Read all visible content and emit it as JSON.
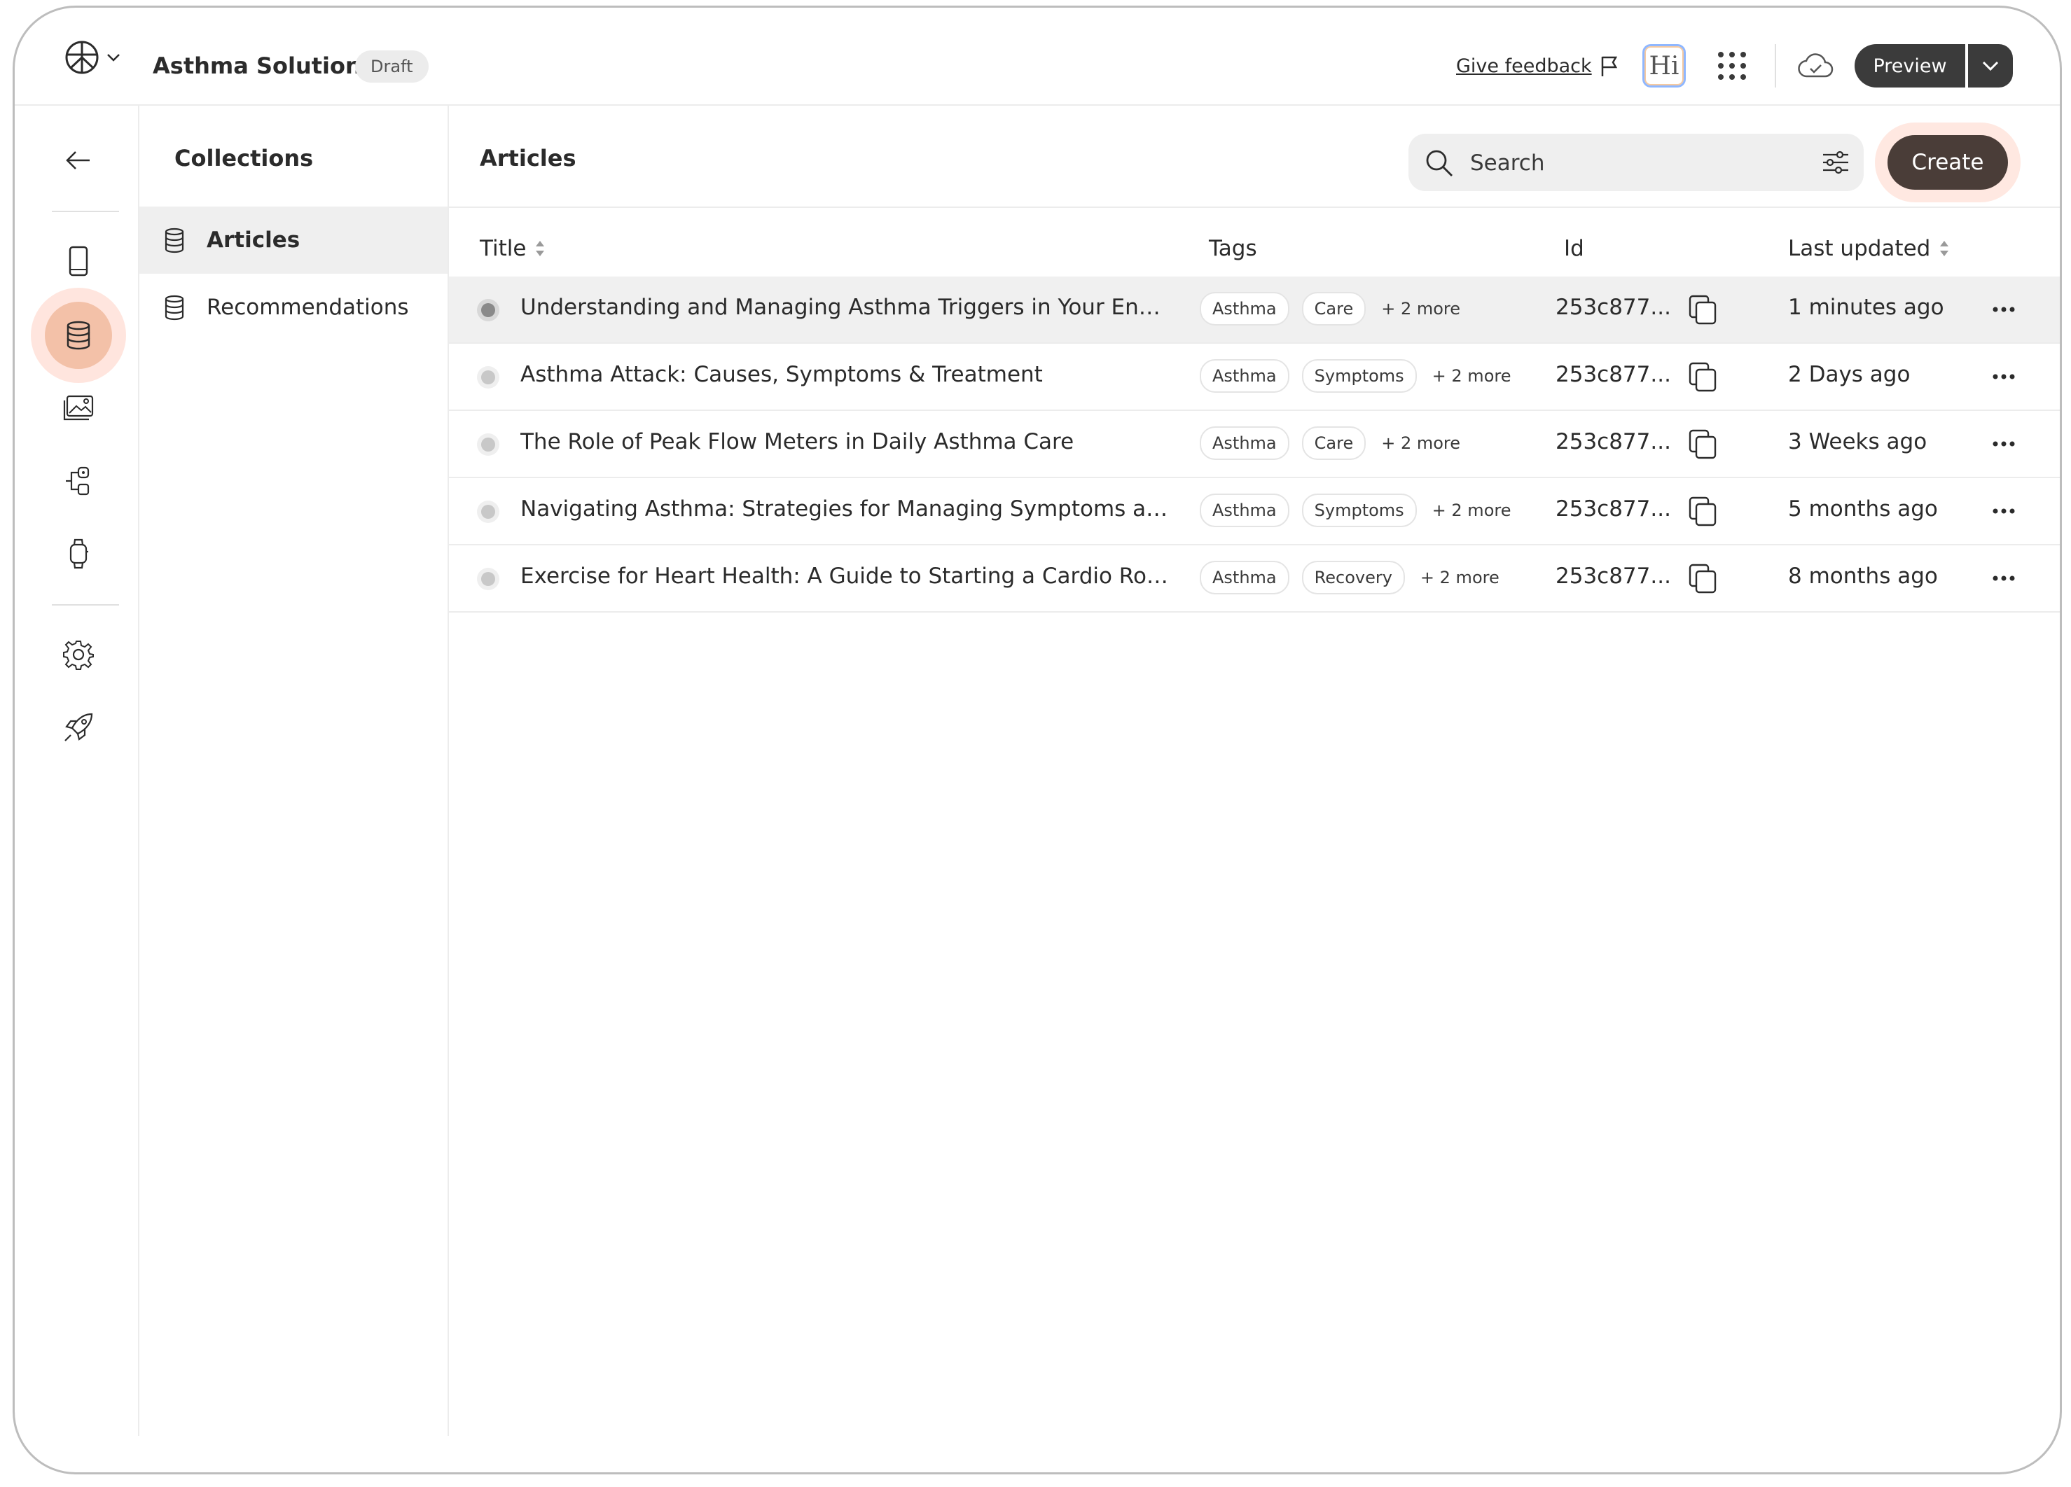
{
  "header": {
    "app_title": "Asthma Solution",
    "status_badge": "Draft",
    "feedback_label": "Give feedback",
    "hi_label": "Hi",
    "preview_label": "Preview"
  },
  "collections": {
    "heading": "Collections",
    "items": [
      {
        "label": "Articles",
        "active": true
      },
      {
        "label": "Recommendations",
        "active": false
      }
    ]
  },
  "main": {
    "title": "Articles",
    "search_placeholder": "Search",
    "create_label": "Create",
    "columns": {
      "title": "Title",
      "tags": "Tags",
      "id": "Id",
      "last_updated": "Last updated"
    },
    "rows": [
      {
        "title": "Understanding and Managing Asthma Triggers in Your Envi...",
        "tags": [
          "Asthma",
          "Care"
        ],
        "more": "+ 2 more",
        "id": "253c877...",
        "updated": "1 minutes ago",
        "selected": true
      },
      {
        "title": "Asthma Attack: Causes, Symptoms & Treatment",
        "tags": [
          "Asthma",
          "Symptoms"
        ],
        "more": "+ 2 more",
        "id": "253c877...",
        "updated": "2 Days ago",
        "selected": false
      },
      {
        "title": "The Role of Peak Flow Meters in Daily Asthma Care",
        "tags": [
          "Asthma",
          "Care"
        ],
        "more": "+ 2 more",
        "id": "253c877...",
        "updated": "3 Weeks ago",
        "selected": false
      },
      {
        "title": "Navigating Asthma: Strategies for Managing Symptoms at...",
        "tags": [
          "Asthma",
          "Symptoms"
        ],
        "more": "+ 2 more",
        "id": "253c877...",
        "updated": "5 months ago",
        "selected": false
      },
      {
        "title": "Exercise for Heart Health: A Guide to Starting a Cardio Rout...",
        "tags": [
          "Asthma",
          "Recovery"
        ],
        "more": "+ 2 more",
        "id": "253c877...",
        "updated": "8 months ago",
        "selected": false
      }
    ]
  },
  "icons": {
    "logo": "peace-logo-icon",
    "rail": [
      "arrow-left-icon",
      "mobile-device-icon",
      "database-icon",
      "image-gallery-icon",
      "workflow-icon",
      "smartwatch-icon",
      "gear-icon",
      "rocket-icon"
    ]
  },
  "colors": {
    "primary_button": "#4a3d38",
    "preview_button": "#3b3b3b",
    "active_highlight": "#f3c1a8"
  }
}
